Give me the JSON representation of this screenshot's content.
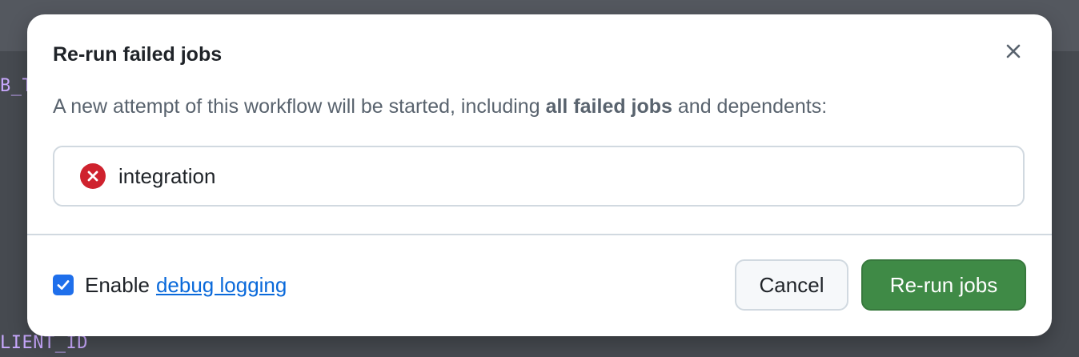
{
  "background": {
    "code_line_1": "B_T",
    "code_line_2": "LIENT_ID"
  },
  "dialog": {
    "title": "Re-run failed jobs",
    "close_icon": "x-icon",
    "description": {
      "prefix": "A new attempt of this workflow will be started, including ",
      "emphasis": "all failed jobs",
      "suffix": " and dependents:"
    },
    "jobs": [
      {
        "name": "integration",
        "status": "failed",
        "icon": "x-circle-fill-icon"
      }
    ],
    "debug": {
      "checked": true,
      "label": "Enable",
      "link_text": "debug logging"
    },
    "buttons": {
      "cancel": "Cancel",
      "rerun": "Re-run jobs"
    }
  },
  "colors": {
    "primary_green": "#3f8a46",
    "failure_red": "#cf222e",
    "link_blue": "#0969da",
    "checkbox_blue": "#1f6feb"
  }
}
